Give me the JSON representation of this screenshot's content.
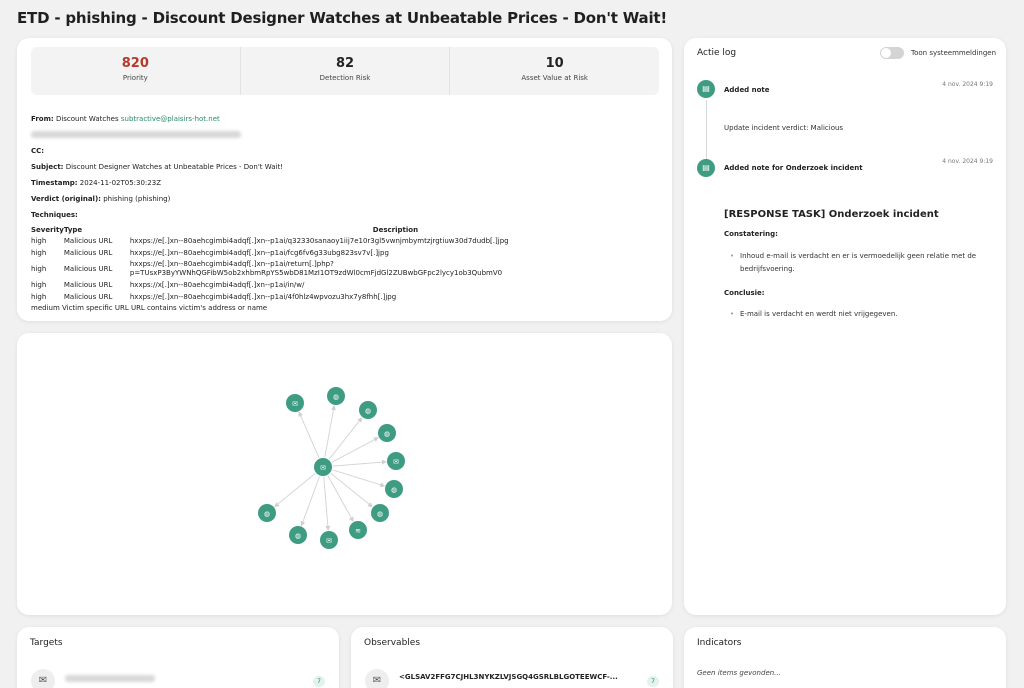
{
  "page": {
    "title": "ETD - phishing - Discount Designer Watches at Unbeatable Prices - Don't Wait!"
  },
  "stats": [
    {
      "value": "820",
      "label": "Priority",
      "color": "#b33a2c"
    },
    {
      "value": "82",
      "label": "Detection Risk"
    },
    {
      "value": "10",
      "label": "Asset Value at Risk"
    }
  ],
  "email": {
    "from_label": "From:",
    "from_name": "Discount Watches",
    "from_address": "subtractive@plaisirs-hot.net",
    "cc_label": "CC:",
    "subject_label": "Subject:",
    "subject": "Discount Designer Watches at Unbeatable Prices - Don't Wait!",
    "timestamp_label": "Timestamp:",
    "timestamp": "2024-11-02T05:30:23Z",
    "verdict_label": "Verdict (original):",
    "verdict": "phishing (phishing)",
    "techniques_label": "Techniques:",
    "table_headers": {
      "severity": "Severity",
      "type": "Type",
      "description": "Description"
    },
    "techniques": [
      {
        "severity": "high",
        "type": "Malicious URL",
        "description": "hxxps://e[.]xn--80aehcgimbi4adqf[.]xn--p1ai/q32330sanaoy1iij7e10r3gl5vwnjmbymtzjrgtiuw30d7dudb[.]jpg"
      },
      {
        "severity": "high",
        "type": "Malicious URL",
        "description": "hxxps://e[.]xn--80aehcgimbi4adqf[.]xn--p1ai/fcg6fv6g33ubg823sv7v[.]jpg"
      },
      {
        "severity": "high",
        "type": "Malicious URL",
        "description": "hxxps://e[.]xn--80aehcgimbi4adqf[.]xn--p1ai/return[.]php?",
        "description2": "p=TUsxP3ByYWNhQGFibW5ob2xhbmRpYS5wbD81MzI1OT9zdWl0cmFjdGl2ZUBwbGFpc2lycy1ob3QubmV0"
      },
      {
        "severity": "high",
        "type": "Malicious URL",
        "description": "hxxps://x[.]xn--80aehcgimbi4adqf[.]xn--p1ai/in/w/"
      },
      {
        "severity": "high",
        "type": "Malicious URL",
        "description": "hxxps://e[.]xn--80aehcgimbi4adqf[.]xn--p1ai/4f0hlz4wpvozu3hx7y8fhh[.]jpg"
      }
    ],
    "medium_line": "medium Victim specific URL URL contains victim's address or name"
  },
  "graph": {
    "center": {
      "icon": "mail-icon"
    },
    "nodes": [
      {
        "icon": "mail-icon"
      },
      {
        "icon": "globe-icon"
      },
      {
        "icon": "globe-icon"
      },
      {
        "icon": "globe-icon"
      },
      {
        "icon": "mail-check-icon"
      },
      {
        "icon": "globe-icon"
      },
      {
        "icon": "globe-icon"
      },
      {
        "icon": "rss-icon"
      },
      {
        "icon": "mail-icon"
      },
      {
        "icon": "globe-icon"
      },
      {
        "icon": "globe-icon"
      }
    ],
    "accent": "#3e9c82"
  },
  "log": {
    "title": "Actie log",
    "toggle_label": "Toon systeemmeldingen",
    "entries": [
      {
        "title": "Added note",
        "date": "4 nov. 2024 9:19",
        "text": "Update incident verdict: Malicious"
      },
      {
        "title": "Added note for Onderzoek incident",
        "date": "4 nov. 2024 9:19"
      }
    ],
    "task": {
      "title": "[RESPONSE TASK] Onderzoek incident",
      "constatering_label": "Constatering:",
      "constatering": "Inhoud e-mail is verdacht en er is vermoedelijk geen relatie met de bedrijfsvoering.",
      "conclusie_label": "Conclusie:",
      "conclusie": "E-mail is verdacht en werdt niet vrijgegeven."
    }
  },
  "targets": {
    "title": "Targets",
    "count": "7"
  },
  "observables": {
    "title": "Observables",
    "item": "<GLSAV2FFG7CJHL3NYKZLVJSGQ4GSRLBLGOTEEWCF-...",
    "count": "7"
  },
  "indicators": {
    "title": "Indicators",
    "empty": "Geen items gevonden..."
  }
}
